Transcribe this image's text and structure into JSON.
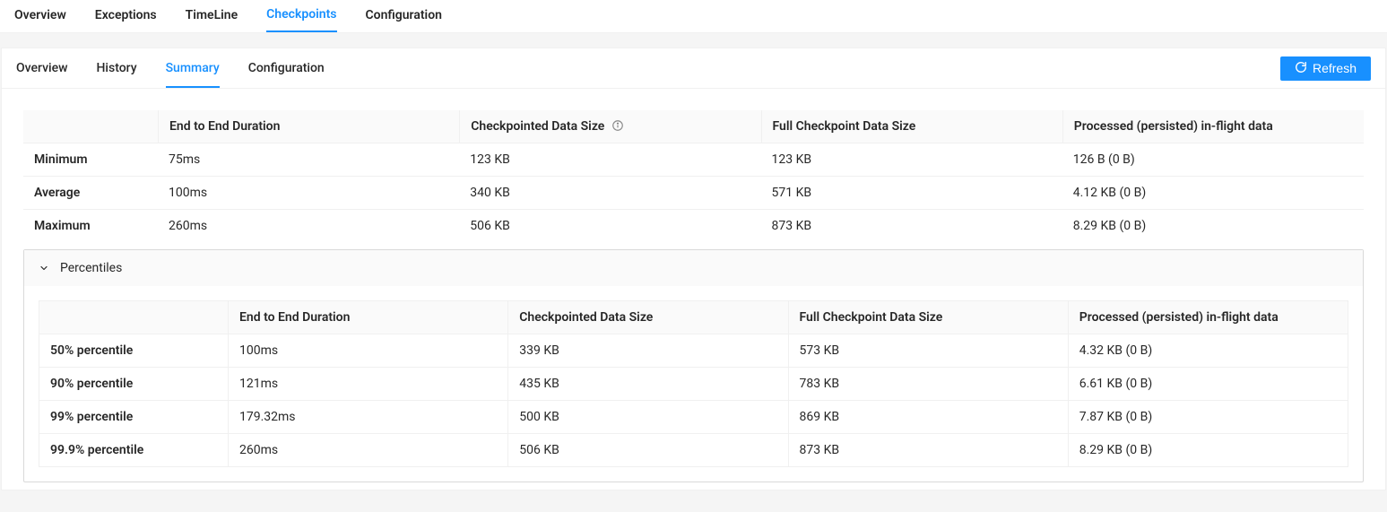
{
  "topTabs": {
    "items": [
      {
        "label": "Overview"
      },
      {
        "label": "Exceptions"
      },
      {
        "label": "TimeLine"
      },
      {
        "label": "Checkpoints"
      },
      {
        "label": "Configuration"
      }
    ],
    "activeIndex": 3
  },
  "subTabs": {
    "items": [
      {
        "label": "Overview"
      },
      {
        "label": "History"
      },
      {
        "label": "Summary"
      },
      {
        "label": "Configuration"
      }
    ],
    "activeIndex": 2
  },
  "refreshLabel": "Refresh",
  "summaryTable": {
    "headers": [
      "",
      "End to End Duration",
      "Checkpointed Data Size",
      "Full Checkpoint Data Size",
      "Processed (persisted) in-flight data"
    ],
    "rows": [
      {
        "label": "Minimum",
        "duration": "75ms",
        "ckpt": "123 KB",
        "full": "123 KB",
        "inflight": "126 B (0 B)"
      },
      {
        "label": "Average",
        "duration": "100ms",
        "ckpt": "340 KB",
        "full": "571 KB",
        "inflight": "4.12 KB (0 B)"
      },
      {
        "label": "Maximum",
        "duration": "260ms",
        "ckpt": "506 KB",
        "full": "873 KB",
        "inflight": "8.29 KB (0 B)"
      }
    ]
  },
  "percentiles": {
    "title": "Percentiles",
    "headers": [
      "",
      "End to End Duration",
      "Checkpointed Data Size",
      "Full Checkpoint Data Size",
      "Processed (persisted) in-flight data"
    ],
    "rows": [
      {
        "label": "50% percentile",
        "duration": "100ms",
        "ckpt": "339 KB",
        "full": "573 KB",
        "inflight": "4.32 KB (0 B)"
      },
      {
        "label": "90% percentile",
        "duration": "121ms",
        "ckpt": "435 KB",
        "full": "783 KB",
        "inflight": "6.61 KB (0 B)"
      },
      {
        "label": "99% percentile",
        "duration": "179.32ms",
        "ckpt": "500 KB",
        "full": "869 KB",
        "inflight": "7.87 KB (0 B)"
      },
      {
        "label": "99.9% percentile",
        "duration": "260ms",
        "ckpt": "506 KB",
        "full": "873 KB",
        "inflight": "8.29 KB (0 B)"
      }
    ]
  }
}
